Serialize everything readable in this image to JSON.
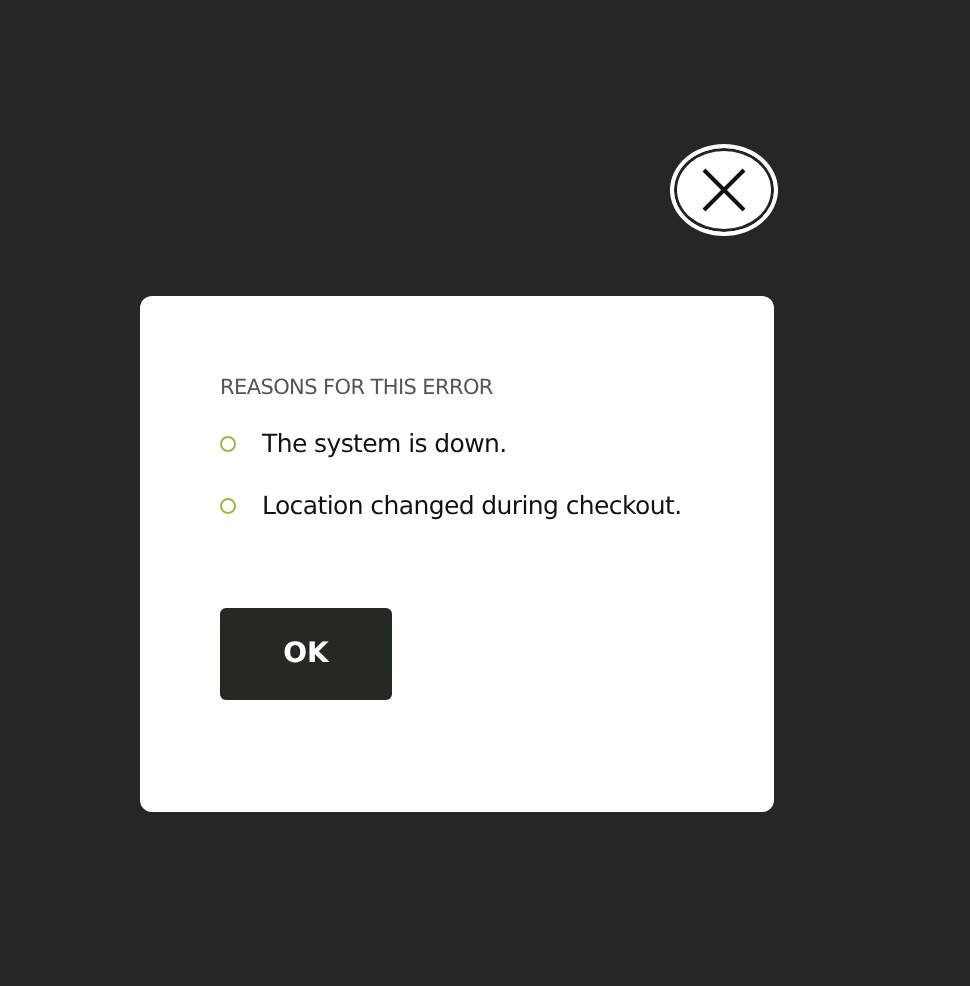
{
  "dialog": {
    "heading": "REASONS FOR THIS ERROR",
    "reasons": [
      "The system is down.",
      "Location changed during checkout."
    ],
    "button": "OK"
  }
}
